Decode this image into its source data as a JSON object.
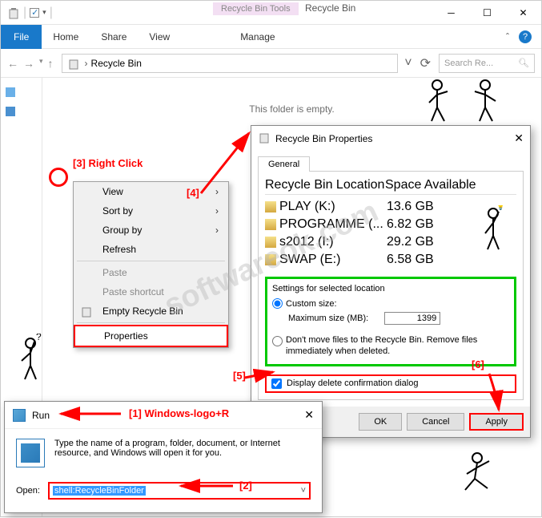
{
  "explorer": {
    "tool_header": "Recycle Bin Tools",
    "tool_header2": "Recycle Bin",
    "file_tab": "File",
    "tabs": [
      "Home",
      "Share",
      "View"
    ],
    "tool_tab": "Manage",
    "breadcrumb": "Recycle Bin",
    "search_placeholder": "Search Re...",
    "empty_msg": "This folder is empty."
  },
  "ctx": {
    "items": [
      {
        "label": "View",
        "arrow": true
      },
      {
        "label": "Sort by",
        "arrow": true
      },
      {
        "label": "Group by",
        "arrow": true
      },
      {
        "label": "Refresh"
      },
      {
        "sep": true
      },
      {
        "label": "Paste",
        "disabled": true
      },
      {
        "label": "Paste shortcut",
        "disabled": true
      },
      {
        "label": "Empty Recycle Bin",
        "icon": true
      },
      {
        "sep": true
      },
      {
        "label": "Properties",
        "highlighted": true
      }
    ]
  },
  "props": {
    "title": "Recycle Bin Properties",
    "tab": "General",
    "col1": "Recycle Bin Location",
    "col2": "Space Available",
    "rows": [
      {
        "name": "PLAY (K:)",
        "space": "13.6 GB"
      },
      {
        "name": "PROGRAMME (...",
        "space": "6.82 GB"
      },
      {
        "name": "s2012 (I:)",
        "space": "29.2 GB"
      },
      {
        "name": "SWAP (E:)",
        "space": "6.58 GB"
      }
    ],
    "settings_title": "Settings for selected location",
    "custom_size": "Custom size:",
    "max_size": "Maximum size (MB):",
    "max_value": "1399",
    "dont_move": "Don't move files to the Recycle Bin. Remove files immediately when deleted.",
    "display_confirm": "Display delete confirmation dialog",
    "ok": "OK",
    "cancel": "Cancel",
    "apply": "Apply"
  },
  "run": {
    "title": "Run",
    "desc": "Type the name of a program, folder, document, or Internet resource, and Windows will open it for you.",
    "label": "Open:",
    "value": "shell:RecycleBinFolder"
  },
  "annot": {
    "a1": "[1] Windows-logo+R",
    "a2": "[2]",
    "a3": "[3] Right Click",
    "a4": "[4]",
    "a5": "[5]",
    "a6": "[6]"
  },
  "watermark": "softwareok.com"
}
